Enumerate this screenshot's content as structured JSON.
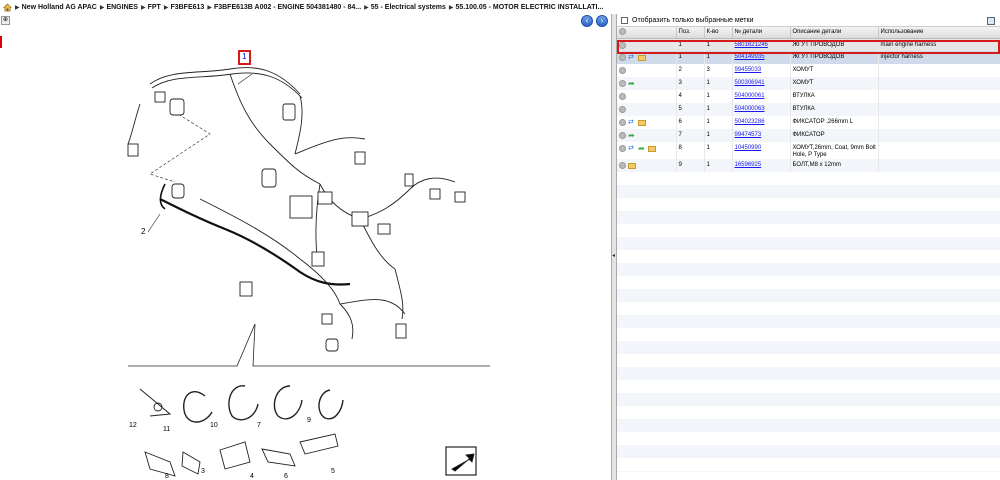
{
  "breadcrumb": {
    "items": [
      "New Holland AG APAC",
      "ENGINES",
      "FPT",
      "F3BFE613",
      "F3BFE613B A002 - ENGINE 504381480 - 84...",
      "55 - Electrical systems",
      "55.100.05 - MOTOR ELECTRIC INSTALLATI..."
    ]
  },
  "diagram": {
    "callouts": [
      "1",
      "2",
      "3",
      "4",
      "5",
      "6",
      "7",
      "8",
      "9",
      "10",
      "11",
      "12"
    ]
  },
  "filter": {
    "label": "Отобразить только выбранные метки"
  },
  "parts_table": {
    "columns": [
      "Поз.",
      "К-во",
      "№ детали",
      "Описание детали",
      "Использование"
    ],
    "rows": [
      {
        "pos": "1",
        "qty": "1",
        "part": "5801621246",
        "desc": "ЖГУТ ПРОВОДОВ",
        "usage": "main engine harness",
        "icons": [
          "circle"
        ]
      },
      {
        "pos": "1",
        "qty": "1",
        "part": "504149935",
        "desc": "ЖГУТ ПРОВОДОВ",
        "usage": "injector harness",
        "icons": [
          "circle",
          "arrows",
          "box"
        ]
      },
      {
        "pos": "2",
        "qty": "3",
        "part": "99455033",
        "desc": "ХОМУТ",
        "usage": "",
        "icons": [
          "circle"
        ]
      },
      {
        "pos": "3",
        "qty": "1",
        "part": "500306941",
        "desc": "ХОМУТ",
        "usage": "",
        "icons": [
          "circle",
          "go"
        ]
      },
      {
        "pos": "4",
        "qty": "1",
        "part": "504000061",
        "desc": "ВТУЛКА",
        "usage": "",
        "icons": [
          "circle"
        ]
      },
      {
        "pos": "5",
        "qty": "1",
        "part": "504000063",
        "desc": "ВТУЛКА",
        "usage": "",
        "icons": [
          "circle"
        ]
      },
      {
        "pos": "6",
        "qty": "1",
        "part": "504023286",
        "desc": "ФИКСАТОР ,266mm L",
        "usage": "",
        "icons": [
          "circle",
          "arrows",
          "box"
        ]
      },
      {
        "pos": "7",
        "qty": "1",
        "part": "99474573",
        "desc": "ФИКСАТОР",
        "usage": "",
        "icons": [
          "circle",
          "go"
        ]
      },
      {
        "pos": "8",
        "qty": "1",
        "part": "10450990",
        "desc": "ХОМУТ,26mm, Coat, 9mm Bolt Hole, P Type",
        "usage": "",
        "icons": [
          "circle",
          "arrows",
          "go",
          "box"
        ]
      },
      {
        "pos": "9",
        "qty": "1",
        "part": "16596925",
        "desc": "БОЛТ,M8 x 12mm",
        "usage": "",
        "icons": [
          "circle",
          "box"
        ]
      }
    ]
  },
  "colors": {
    "selection_outline": "#d61a1a",
    "link": "#1a1aee",
    "nav_button": "#2c64c8"
  }
}
